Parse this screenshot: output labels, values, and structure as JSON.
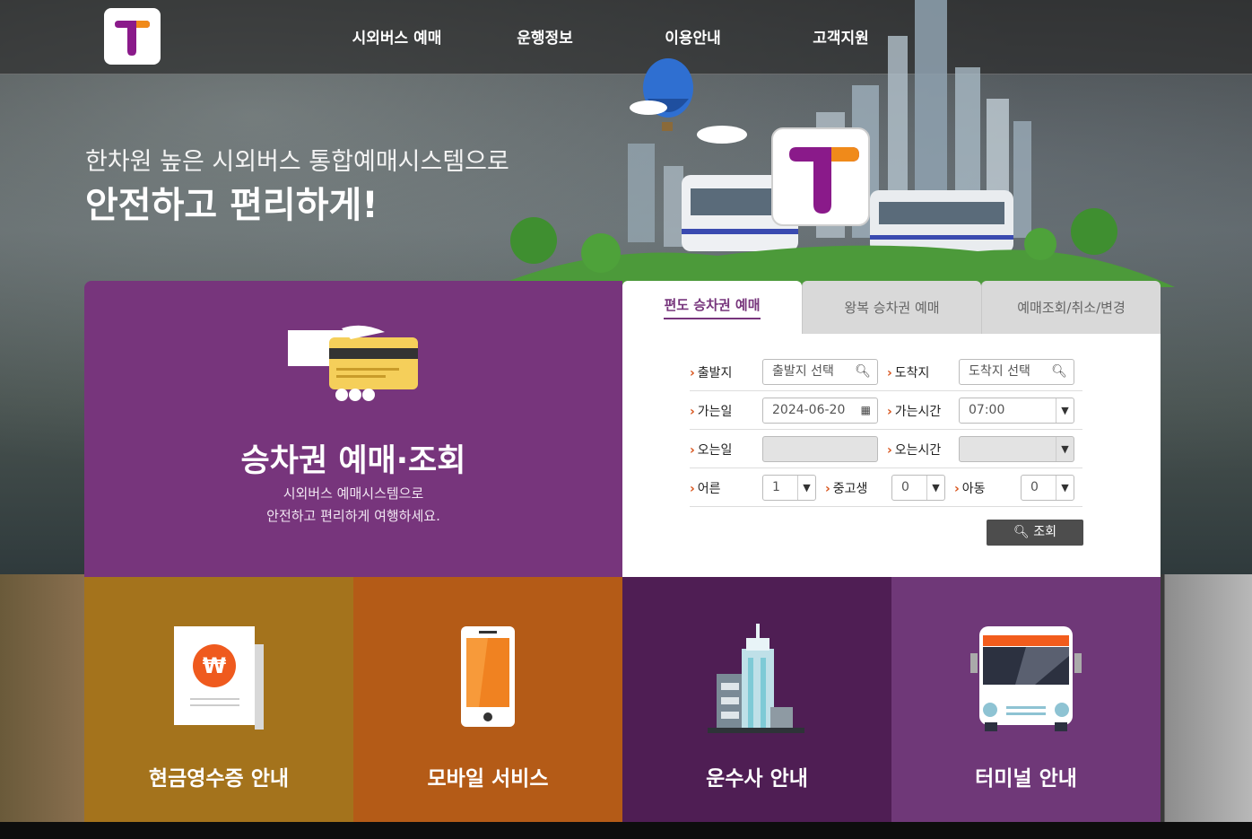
{
  "header": {
    "logo_letter": "T",
    "nav": [
      "시외버스 예매",
      "운행정보",
      "이용안내",
      "고객지원"
    ]
  },
  "hero": {
    "subtitle": "한차원 높은 시외버스 통합예매시스템으로",
    "title": "안전하고 편리하게!"
  },
  "ticket_panel": {
    "title": "승차권 예매·조회",
    "desc_line1": "시외버스 예매시스템으로",
    "desc_line2": "안전하고 편리하게 여행하세요."
  },
  "tabs": [
    "편도 승차권 예매",
    "왕복 승차권 예매",
    "예매조회/취소/변경"
  ],
  "form": {
    "departure_label": "출발지",
    "departure_placeholder": "출발지 선택",
    "arrival_label": "도착지",
    "arrival_placeholder": "도착지 선택",
    "go_date_label": "가는일",
    "go_date_value": "2024-06-20",
    "go_time_label": "가는시간",
    "go_time_value": "07:00",
    "return_date_label": "오는일",
    "return_time_label": "오는시간",
    "adult_label": "어른",
    "adult_value": "1",
    "student_label": "중고생",
    "student_value": "0",
    "child_label": "아동",
    "child_value": "0",
    "search_label": "조회"
  },
  "tiles": [
    {
      "label": "현금영수증 안내",
      "color": "#a4731c",
      "icon": "receipt-icon"
    },
    {
      "label": "모바일 서비스",
      "color": "#b45b17",
      "icon": "mobile-phone-icon"
    },
    {
      "label": "운수사 안내",
      "color": "#4f1e54",
      "icon": "building-icon"
    },
    {
      "label": "터미널 안내",
      "color": "#6f3878",
      "icon": "bus-icon"
    }
  ],
  "colors": {
    "brand_purple": "#77357c",
    "accent_orange": "#d8541c"
  }
}
